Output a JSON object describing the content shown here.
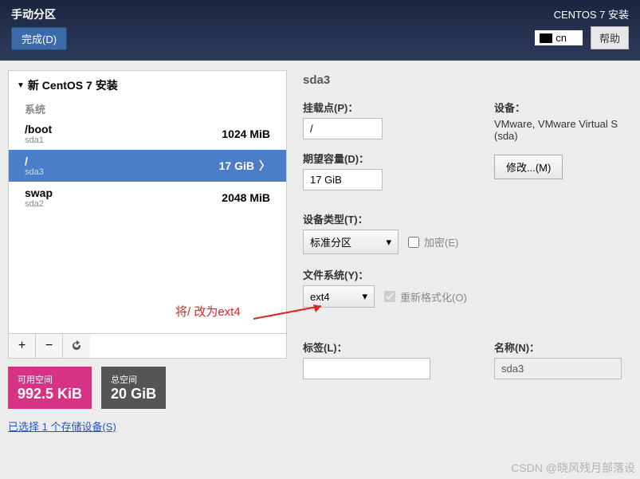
{
  "header": {
    "title": "手动分区",
    "done_btn": "完成(D)",
    "install_title": "CENTOS 7 安装",
    "lang": "cn",
    "help_btn": "帮助"
  },
  "left": {
    "section_title": "新 CentOS 7 安装",
    "system_label": "系统",
    "partitions": [
      {
        "name": "/boot",
        "dev": "sda1",
        "size": "1024 MiB",
        "selected": false
      },
      {
        "name": "/",
        "dev": "sda3",
        "size": "17 GiB",
        "selected": true
      },
      {
        "name": "swap",
        "dev": "sda2",
        "size": "2048 MiB",
        "selected": false
      }
    ],
    "add": "+",
    "remove": "−",
    "refresh": "↻",
    "avail_label": "可用空间",
    "avail_val": "992.5 KiB",
    "total_label": "总空间",
    "total_val": "20 GiB",
    "selected_link": "已选择 1 个存储设备(S)"
  },
  "right": {
    "selected": "sda3",
    "mount_label": "挂载点(P)：",
    "mount_val": "/",
    "capacity_label": "期望容量(D)：",
    "capacity_val": "17 GiB",
    "device_label": "设备：",
    "device_text": "VMware, VMware Virtual S (sda)",
    "modify_btn": "修改...(M)",
    "devtype_label": "设备类型(T)：",
    "devtype_val": "标准分区",
    "encrypt_label": "加密(E)",
    "fs_label": "文件系统(Y)：",
    "fs_val": "ext4",
    "reformat_label": "重新格式化(O)",
    "tag_label": "标签(L)：",
    "tag_val": "",
    "name_label": "名称(N)：",
    "name_val": "sda3"
  },
  "annotation": "将/ 改为ext4",
  "watermark": "CSDN @晓风残月部落设"
}
